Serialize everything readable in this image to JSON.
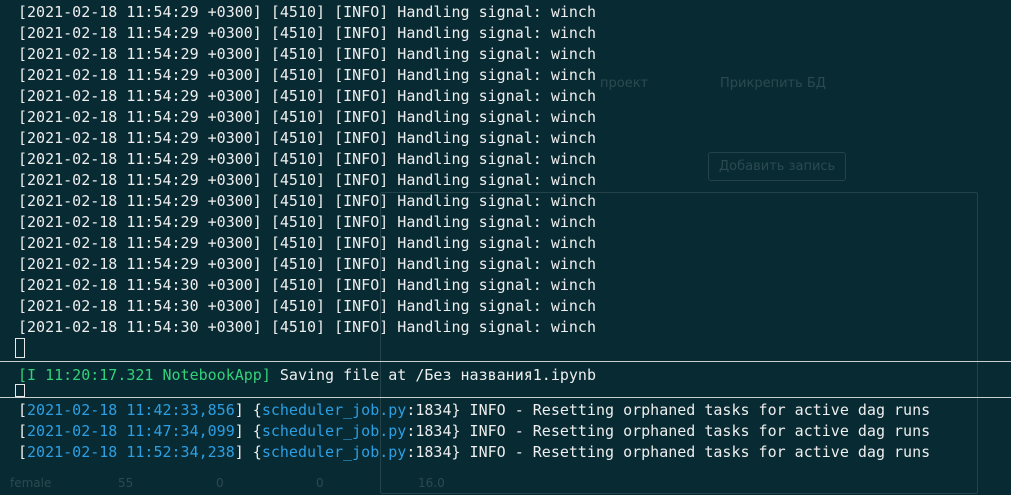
{
  "background_app": {
    "project_button": "проект",
    "attach_db_button": "Прикрепить БД",
    "add_record_button": "Добавить запись",
    "column_female": "female",
    "row_values": [
      "55",
      "0",
      "0",
      "16.0"
    ]
  },
  "pane_top": {
    "lines": [
      "[2021-02-18 11:54:29 +0300] [4510] [INFO] Handling signal: winch",
      "[2021-02-18 11:54:29 +0300] [4510] [INFO] Handling signal: winch",
      "[2021-02-18 11:54:29 +0300] [4510] [INFO] Handling signal: winch",
      "[2021-02-18 11:54:29 +0300] [4510] [INFO] Handling signal: winch",
      "[2021-02-18 11:54:29 +0300] [4510] [INFO] Handling signal: winch",
      "[2021-02-18 11:54:29 +0300] [4510] [INFO] Handling signal: winch",
      "[2021-02-18 11:54:29 +0300] [4510] [INFO] Handling signal: winch",
      "[2021-02-18 11:54:29 +0300] [4510] [INFO] Handling signal: winch",
      "[2021-02-18 11:54:29 +0300] [4510] [INFO] Handling signal: winch",
      "[2021-02-18 11:54:29 +0300] [4510] [INFO] Handling signal: winch",
      "[2021-02-18 11:54:29 +0300] [4510] [INFO] Handling signal: winch",
      "[2021-02-18 11:54:29 +0300] [4510] [INFO] Handling signal: winch",
      "[2021-02-18 11:54:29 +0300] [4510] [INFO] Handling signal: winch",
      "[2021-02-18 11:54:30 +0300] [4510] [INFO] Handling signal: winch",
      "[2021-02-18 11:54:30 +0300] [4510] [INFO] Handling signal: winch",
      "[2021-02-18 11:54:30 +0300] [4510] [INFO] Handling signal: winch"
    ]
  },
  "pane_middle": {
    "prefix": "[I 11:20:17.321 NotebookApp]",
    "message": " Saving file at /Без названия1.ipynb"
  },
  "pane_bottom": {
    "lines": [
      {
        "open": "[",
        "timestamp": "2021-02-18 11:42:33,856",
        "mid": "] {",
        "file": "scheduler_job.py",
        "rest": ":1834} INFO - Resetting orphaned tasks for active dag runs"
      },
      {
        "open": "[",
        "timestamp": "2021-02-18 11:47:34,099",
        "mid": "] {",
        "file": "scheduler_job.py",
        "rest": ":1834} INFO - Resetting orphaned tasks for active dag runs"
      },
      {
        "open": "[",
        "timestamp": "2021-02-18 11:52:34,238",
        "mid": "] {",
        "file": "scheduler_job.py",
        "rest": ":1834} INFO - Resetting orphaned tasks for active dag runs"
      }
    ]
  },
  "colors": {
    "background": "#082a33",
    "text": "#eeeeee",
    "green": "#33d17a",
    "blue": "#2c9fe3"
  }
}
